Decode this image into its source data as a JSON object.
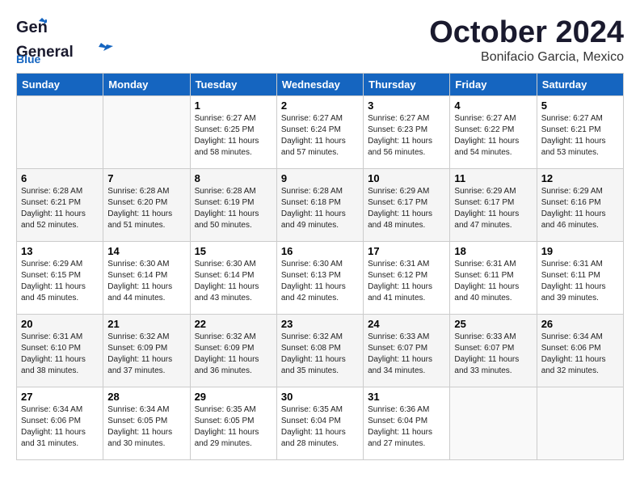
{
  "header": {
    "logo_line1": "General",
    "logo_line2": "Blue",
    "month": "October 2024",
    "location": "Bonifacio Garcia, Mexico"
  },
  "days_of_week": [
    "Sunday",
    "Monday",
    "Tuesday",
    "Wednesday",
    "Thursday",
    "Friday",
    "Saturday"
  ],
  "weeks": [
    [
      {
        "day": "",
        "info": ""
      },
      {
        "day": "",
        "info": ""
      },
      {
        "day": "1",
        "info": "Sunrise: 6:27 AM\nSunset: 6:25 PM\nDaylight: 11 hours and 58 minutes."
      },
      {
        "day": "2",
        "info": "Sunrise: 6:27 AM\nSunset: 6:24 PM\nDaylight: 11 hours and 57 minutes."
      },
      {
        "day": "3",
        "info": "Sunrise: 6:27 AM\nSunset: 6:23 PM\nDaylight: 11 hours and 56 minutes."
      },
      {
        "day": "4",
        "info": "Sunrise: 6:27 AM\nSunset: 6:22 PM\nDaylight: 11 hours and 54 minutes."
      },
      {
        "day": "5",
        "info": "Sunrise: 6:27 AM\nSunset: 6:21 PM\nDaylight: 11 hours and 53 minutes."
      }
    ],
    [
      {
        "day": "6",
        "info": "Sunrise: 6:28 AM\nSunset: 6:21 PM\nDaylight: 11 hours and 52 minutes."
      },
      {
        "day": "7",
        "info": "Sunrise: 6:28 AM\nSunset: 6:20 PM\nDaylight: 11 hours and 51 minutes."
      },
      {
        "day": "8",
        "info": "Sunrise: 6:28 AM\nSunset: 6:19 PM\nDaylight: 11 hours and 50 minutes."
      },
      {
        "day": "9",
        "info": "Sunrise: 6:28 AM\nSunset: 6:18 PM\nDaylight: 11 hours and 49 minutes."
      },
      {
        "day": "10",
        "info": "Sunrise: 6:29 AM\nSunset: 6:17 PM\nDaylight: 11 hours and 48 minutes."
      },
      {
        "day": "11",
        "info": "Sunrise: 6:29 AM\nSunset: 6:17 PM\nDaylight: 11 hours and 47 minutes."
      },
      {
        "day": "12",
        "info": "Sunrise: 6:29 AM\nSunset: 6:16 PM\nDaylight: 11 hours and 46 minutes."
      }
    ],
    [
      {
        "day": "13",
        "info": "Sunrise: 6:29 AM\nSunset: 6:15 PM\nDaylight: 11 hours and 45 minutes."
      },
      {
        "day": "14",
        "info": "Sunrise: 6:30 AM\nSunset: 6:14 PM\nDaylight: 11 hours and 44 minutes."
      },
      {
        "day": "15",
        "info": "Sunrise: 6:30 AM\nSunset: 6:14 PM\nDaylight: 11 hours and 43 minutes."
      },
      {
        "day": "16",
        "info": "Sunrise: 6:30 AM\nSunset: 6:13 PM\nDaylight: 11 hours and 42 minutes."
      },
      {
        "day": "17",
        "info": "Sunrise: 6:31 AM\nSunset: 6:12 PM\nDaylight: 11 hours and 41 minutes."
      },
      {
        "day": "18",
        "info": "Sunrise: 6:31 AM\nSunset: 6:11 PM\nDaylight: 11 hours and 40 minutes."
      },
      {
        "day": "19",
        "info": "Sunrise: 6:31 AM\nSunset: 6:11 PM\nDaylight: 11 hours and 39 minutes."
      }
    ],
    [
      {
        "day": "20",
        "info": "Sunrise: 6:31 AM\nSunset: 6:10 PM\nDaylight: 11 hours and 38 minutes."
      },
      {
        "day": "21",
        "info": "Sunrise: 6:32 AM\nSunset: 6:09 PM\nDaylight: 11 hours and 37 minutes."
      },
      {
        "day": "22",
        "info": "Sunrise: 6:32 AM\nSunset: 6:09 PM\nDaylight: 11 hours and 36 minutes."
      },
      {
        "day": "23",
        "info": "Sunrise: 6:32 AM\nSunset: 6:08 PM\nDaylight: 11 hours and 35 minutes."
      },
      {
        "day": "24",
        "info": "Sunrise: 6:33 AM\nSunset: 6:07 PM\nDaylight: 11 hours and 34 minutes."
      },
      {
        "day": "25",
        "info": "Sunrise: 6:33 AM\nSunset: 6:07 PM\nDaylight: 11 hours and 33 minutes."
      },
      {
        "day": "26",
        "info": "Sunrise: 6:34 AM\nSunset: 6:06 PM\nDaylight: 11 hours and 32 minutes."
      }
    ],
    [
      {
        "day": "27",
        "info": "Sunrise: 6:34 AM\nSunset: 6:06 PM\nDaylight: 11 hours and 31 minutes."
      },
      {
        "day": "28",
        "info": "Sunrise: 6:34 AM\nSunset: 6:05 PM\nDaylight: 11 hours and 30 minutes."
      },
      {
        "day": "29",
        "info": "Sunrise: 6:35 AM\nSunset: 6:05 PM\nDaylight: 11 hours and 29 minutes."
      },
      {
        "day": "30",
        "info": "Sunrise: 6:35 AM\nSunset: 6:04 PM\nDaylight: 11 hours and 28 minutes."
      },
      {
        "day": "31",
        "info": "Sunrise: 6:36 AM\nSunset: 6:04 PM\nDaylight: 11 hours and 27 minutes."
      },
      {
        "day": "",
        "info": ""
      },
      {
        "day": "",
        "info": ""
      }
    ]
  ]
}
